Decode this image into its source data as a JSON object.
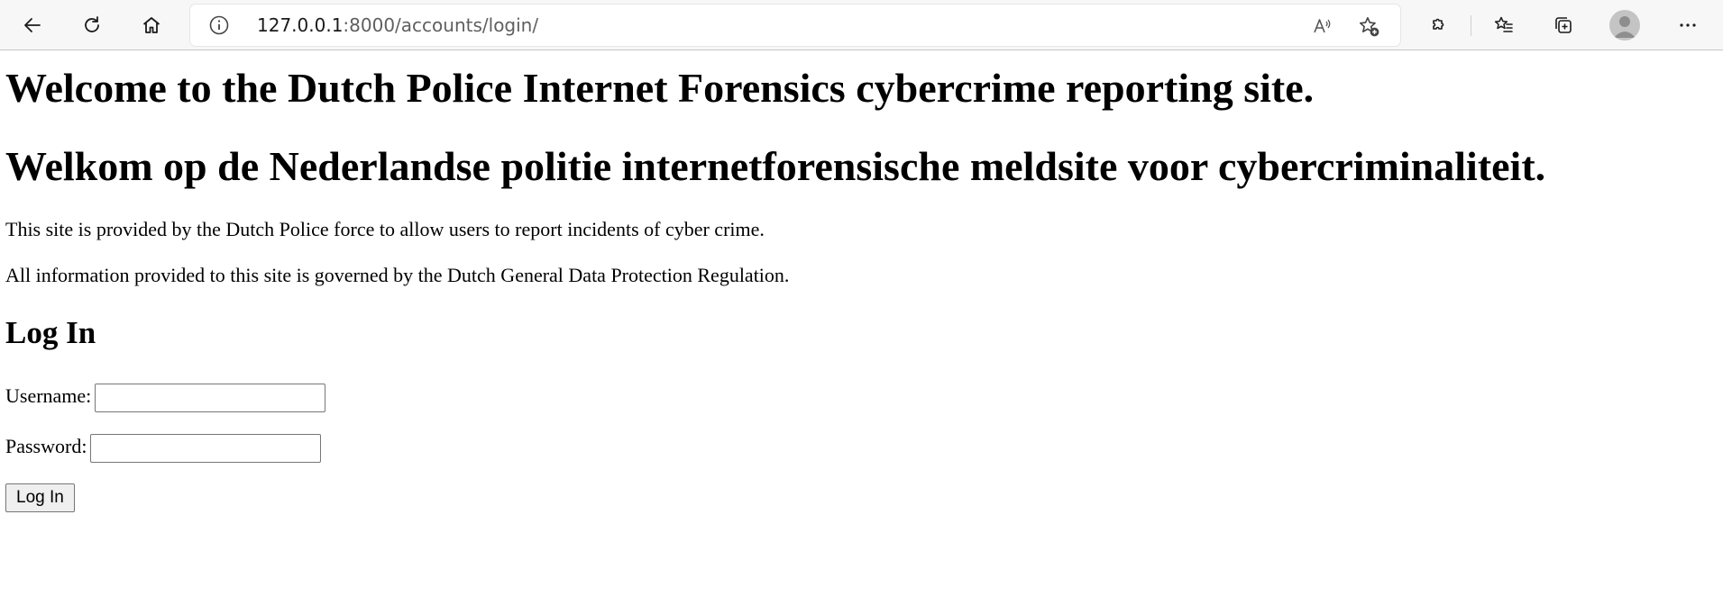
{
  "browser": {
    "url_host": "127.0.0.1",
    "url_rest": ":8000/accounts/login/",
    "icons": {
      "back": "back-arrow-icon",
      "refresh": "refresh-icon",
      "home": "home-icon",
      "info": "info-icon",
      "read_aloud": "read-aloud-icon",
      "add_favorite": "add-favorite-icon",
      "extensions": "extensions-icon",
      "favorites": "favorites-icon",
      "collections": "collections-icon",
      "profile": "profile-avatar-icon",
      "more": "more-icon"
    }
  },
  "page": {
    "heading_en": "Welcome to the Dutch Police Internet Forensics cybercrime reporting site.",
    "heading_nl": "Welkom op de Nederlandse politie internetforensische meldsite voor cybercriminaliteit.",
    "intro": "This site is provided by the Dutch Police force to allow users to report incidents of cyber crime.",
    "gdpr_note": "All information provided to this site is governed by the Dutch General Data Protection Regulation.",
    "login_title": "Log In",
    "username_label": "Username:",
    "username_value": "",
    "password_label": "Password:",
    "password_value": "",
    "login_button": "Log In"
  }
}
